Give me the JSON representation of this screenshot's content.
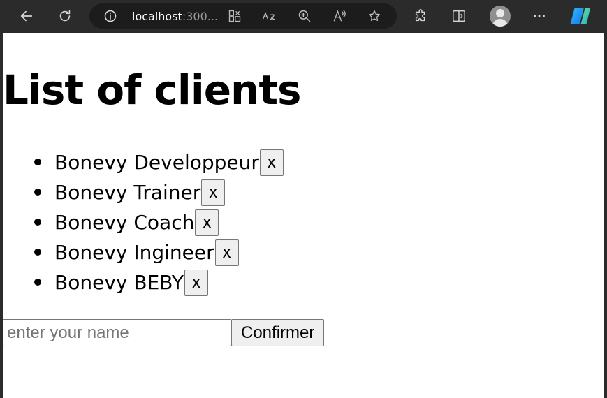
{
  "browser": {
    "url_host": "localhost",
    "url_rest": ":300..."
  },
  "page": {
    "title": "List of clients",
    "clients": [
      {
        "name": "Bonevy Developpeur",
        "remove_label": "x"
      },
      {
        "name": "Bonevy Trainer",
        "remove_label": "x"
      },
      {
        "name": "Bonevy Coach",
        "remove_label": "x"
      },
      {
        "name": "Bonevy Ingineer",
        "remove_label": "x"
      },
      {
        "name": "Bonevy BEBY",
        "remove_label": "x"
      }
    ],
    "form": {
      "input_value": "",
      "input_placeholder": "enter your name",
      "confirm_label": "Confirmer"
    }
  },
  "icons": {
    "back": "arrow-left-icon",
    "refresh": "refresh-icon",
    "info": "info-icon",
    "grid": "app-grid-icon",
    "translate": "translate-icon",
    "zoom": "zoom-icon",
    "read_aloud": "read-aloud-icon",
    "favorite": "star-icon",
    "extensions": "puzzle-icon",
    "split": "split-screen-icon",
    "more": "more-icon",
    "copilot": "copilot-icon"
  }
}
